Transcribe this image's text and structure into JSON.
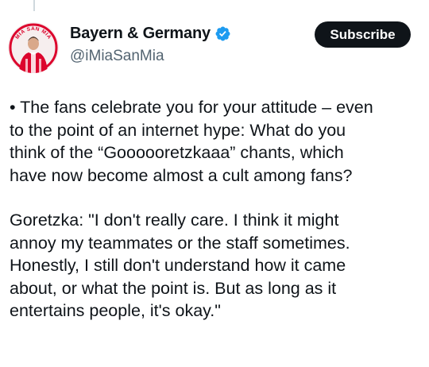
{
  "author": {
    "display_name": "Bayern & Germany",
    "handle": "@iMiaSanMia",
    "verified": true,
    "verified_badge_color": "#1d9bf0",
    "avatar_text": "MIA SAN MIA",
    "avatar_colors": {
      "ring": "#dc052d",
      "jersey": "#dc052d",
      "background": "#f6eeee"
    }
  },
  "subscribe_button": {
    "label": "Subscribe"
  },
  "tweet": {
    "paragraph_1": [
      "• The fans celebrate you for your attitude – even",
      "to the point of an internet hype: What do you",
      "think of the “Goooooretzkaaa” chants, which",
      "have now become almost a cult among fans?"
    ],
    "paragraph_2": [
      "Goretzka: \"I don't really care. I think it might",
      "annoy my teammates or the staff sometimes.",
      "Honestly, I still don't understand how it came",
      "about, or what the point is. But as long as it",
      "entertains people, it's okay.\""
    ]
  }
}
